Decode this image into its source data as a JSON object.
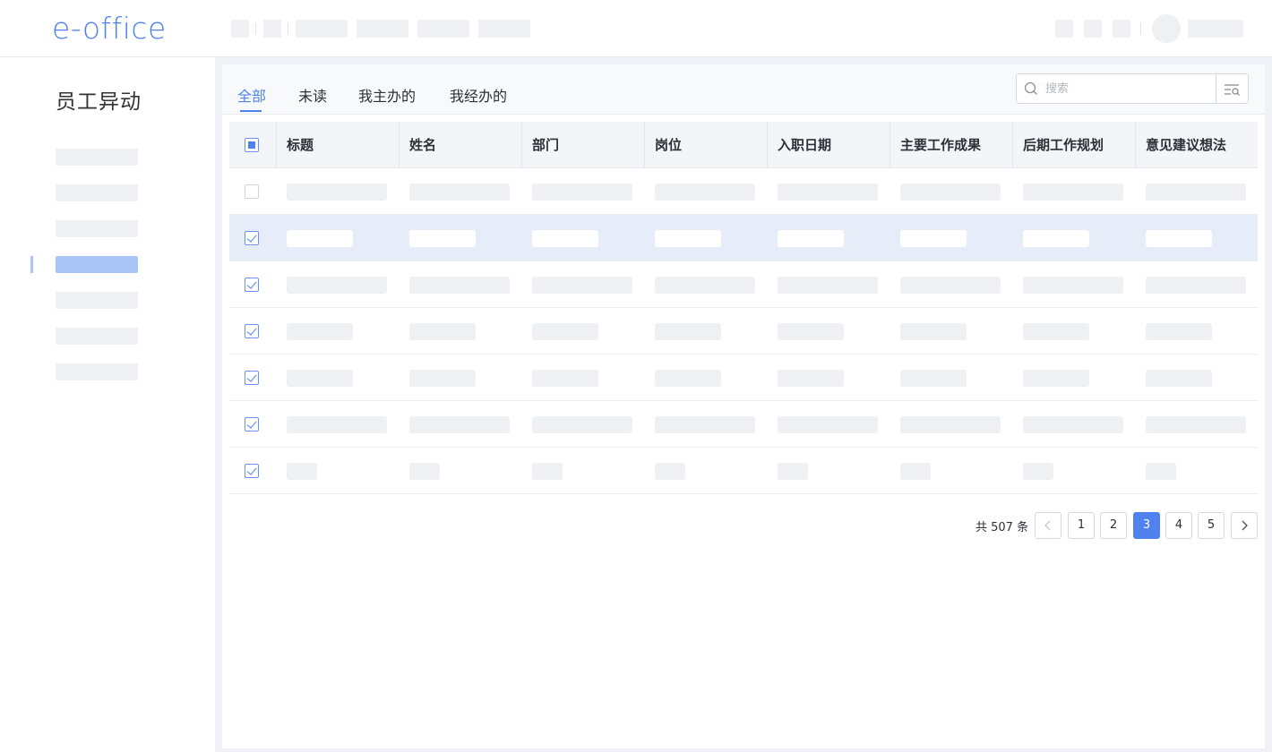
{
  "app": {
    "logo_text": "e-office"
  },
  "sidebar": {
    "title": "员工异动",
    "active_index": 3
  },
  "tabs": [
    {
      "label": "全部",
      "active": true
    },
    {
      "label": "未读",
      "active": false
    },
    {
      "label": "我主办的",
      "active": false
    },
    {
      "label": "我经办的",
      "active": false
    }
  ],
  "search": {
    "placeholder": "搜索",
    "value": ""
  },
  "table": {
    "columns": [
      "标题",
      "姓名",
      "部门",
      "岗位",
      "入职日期",
      "主要工作成果",
      "后期工作规划",
      "意见建议想法"
    ],
    "header_checkbox": "indeterminate",
    "rows": [
      {
        "checked": false,
        "selected": false
      },
      {
        "checked": true,
        "selected": true
      },
      {
        "checked": true,
        "selected": false
      },
      {
        "checked": true,
        "selected": false
      },
      {
        "checked": true,
        "selected": false
      },
      {
        "checked": true,
        "selected": false
      },
      {
        "checked": true,
        "selected": false
      }
    ]
  },
  "pagination": {
    "total_label": "共 507 条",
    "pages": [
      "1",
      "2",
      "3",
      "4",
      "5"
    ],
    "current": "3"
  },
  "colors": {
    "accent": "#4f82ee",
    "selected_row": "#e6ecf8",
    "placeholder": "#eef0f4"
  },
  "icons": {
    "search": "search-icon",
    "filter": "filter-search-icon",
    "prev": "chevron-left-icon",
    "next": "chevron-right-icon"
  }
}
